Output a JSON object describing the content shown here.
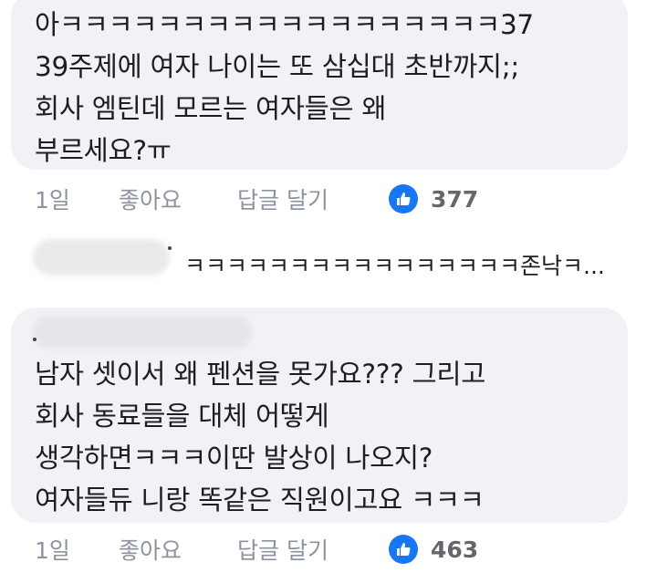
{
  "comments": [
    {
      "lines": [
        "아ㅋㅋㅋㅋㅋㅋㅋㅋㅋㅋㅋㅋㅋㅋㅋㅋㅋㅋ37",
        "39주제에 여자 나이는 또 삼십대 초반까지;;",
        "회사 엠틴데 모르는 여자들은 왜",
        "부르세요?ㅠ"
      ],
      "time": "1일",
      "like_label": "좋아요",
      "reply_label": "답글 달기",
      "reaction_count": "377"
    },
    {
      "lines": [
        "남자 셋이서 왜 펜션을 못가요??? 그리고",
        "회사 동료들을 대체 어떻게",
        "생각하면ㅋㅋㅋ이딴 발상이 나오지?",
        "여자들듀 니랑 똑같은 직원이고요 ㅋㅋㅋ"
      ],
      "time": "1일",
      "like_label": "좋아요",
      "reply_label": "답글 달기",
      "reaction_count": "463"
    }
  ],
  "reply_preview": {
    "text": "ㅋㅋㅋㅋㅋㅋㅋㅋㅋㅋㅋㅋㅋㅋㅋㅋ존낙ㅋ..."
  },
  "colors": {
    "bubble": "#f0f2f5",
    "meta_text": "#8d949e",
    "like_icon": "#1877f2",
    "body_text": "#1c1e21"
  },
  "icons": {
    "reaction": "thumbs-up-icon"
  }
}
